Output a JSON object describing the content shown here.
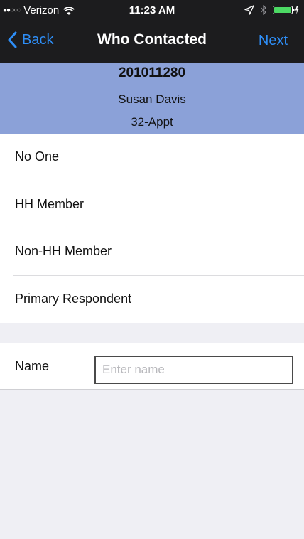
{
  "status_bar": {
    "signal": "●●○○○",
    "carrier": "Verizon",
    "time": "11:23 AM",
    "icons": [
      "wifi-icon",
      "location-icon",
      "bluetooth-icon",
      "battery-icon"
    ]
  },
  "nav": {
    "back_label": "Back",
    "title": "Who Contacted",
    "next_label": "Next",
    "accent_color": "#2e8ef7"
  },
  "header": {
    "case_id": "201011280",
    "respondent_name": "Susan Davis",
    "appointment": "32-Appt",
    "background_color": "#8ba1d8"
  },
  "options": [
    {
      "label": "No One"
    },
    {
      "label": "HH Member"
    },
    {
      "label": "Non-HH Member"
    },
    {
      "label": "Primary Respondent"
    }
  ],
  "name_field": {
    "label": "Name",
    "value": "",
    "placeholder": "Enter name"
  }
}
